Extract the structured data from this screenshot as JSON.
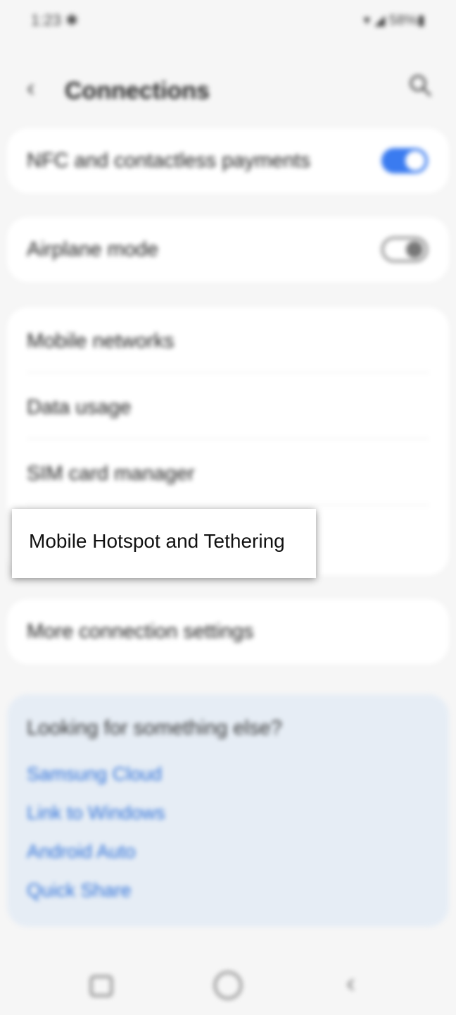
{
  "status_bar": {
    "time": "1:23 ✱",
    "icons": "▾ ◢ 58%▮"
  },
  "header": {
    "title": "Connections",
    "back_icon": "chevron-left-icon",
    "search_icon": "search-icon"
  },
  "toggles": {
    "nfc": {
      "label": "NFC and contactless payments",
      "on": true
    },
    "airplane": {
      "label": "Airplane mode",
      "on": false
    }
  },
  "network_items": [
    {
      "label": "Mobile networks"
    },
    {
      "label": "Data usage"
    },
    {
      "label": "SIM card manager"
    }
  ],
  "more_settings": {
    "label": "More connection settings"
  },
  "suggestions": {
    "title": "Looking for something else?",
    "links": [
      "Samsung Cloud",
      "Link to Windows",
      "Android Auto",
      "Quick Share"
    ]
  },
  "highlight": {
    "label": "Mobile Hotspot and Tethering"
  },
  "colors": {
    "accent": "#3a7bf0",
    "link": "#2c6fd8",
    "suggest_bg": "#e6edf5"
  }
}
